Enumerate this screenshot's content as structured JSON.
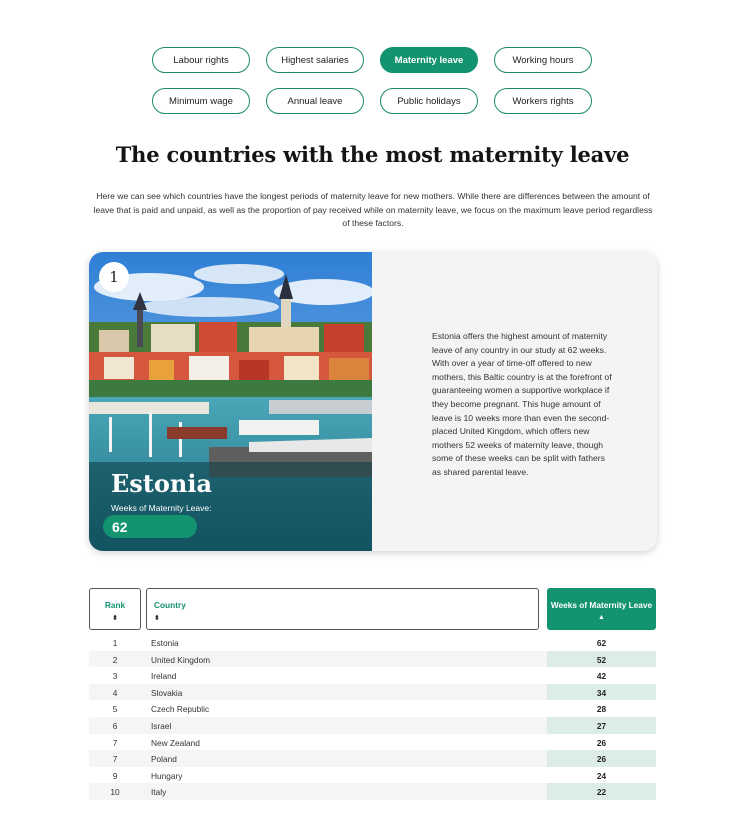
{
  "tabs": [
    {
      "label": "Labour rights",
      "active": false
    },
    {
      "label": "Highest salaries",
      "active": false
    },
    {
      "label": "Maternity leave",
      "active": true
    },
    {
      "label": "Working hours",
      "active": false
    },
    {
      "label": "Minimum wage",
      "active": false
    },
    {
      "label": "Annual leave",
      "active": false
    },
    {
      "label": "Public holidays",
      "active": false
    },
    {
      "label": "Workers rights",
      "active": false
    }
  ],
  "page": {
    "title": "The countries with the most maternity leave",
    "intro": "Here we can see which countries have the longest periods of maternity leave for new mothers. While there are differences between the amount of leave that is paid and unpaid, as well as the proportion of pay received while on maternity leave, we focus on the maximum leave period regardless of these factors."
  },
  "card": {
    "rank": "1",
    "country": "Estonia",
    "weeks_label": "Weeks of Maternity Leave:",
    "weeks_value": "62",
    "description": "Estonia offers the highest amount of maternity leave of any country in our study at 62 weeks. With over a year of time-off offered to new mothers, this Baltic country is at the forefront of guaranteeing women a supportive workplace if they become pregnant. This huge amount of leave is 10 weeks more than even the second-placed United Kingdom, which offers new mothers 52 weeks of maternity leave, though some of these weeks can be split with fathers as shared parental leave."
  },
  "table": {
    "headers": {
      "rank": "Rank",
      "country": "Country",
      "weeks": "Weeks of Maternity Leave"
    },
    "sort_icons": {
      "rank": "⬍",
      "country": "⬍",
      "weeks": "▲"
    },
    "rows": [
      {
        "rank": "1",
        "country": "Estonia",
        "weeks": "62"
      },
      {
        "rank": "2",
        "country": "United Kingdom",
        "weeks": "52"
      },
      {
        "rank": "3",
        "country": "Ireland",
        "weeks": "42"
      },
      {
        "rank": "4",
        "country": "Slovakia",
        "weeks": "34"
      },
      {
        "rank": "5",
        "country": "Czech Republic",
        "weeks": "28"
      },
      {
        "rank": "6",
        "country": "Israel",
        "weeks": "27"
      },
      {
        "rank": "7",
        "country": "New Zealand",
        "weeks": "26"
      },
      {
        "rank": "7",
        "country": "Poland",
        "weeks": "26"
      },
      {
        "rank": "9",
        "country": "Hungary",
        "weeks": "24"
      },
      {
        "rank": "10",
        "country": "Italy",
        "weeks": "22"
      }
    ]
  },
  "colors": {
    "accent": "#13936f",
    "accent_light": "#dcece6",
    "card_bg": "#f4f4f4"
  }
}
